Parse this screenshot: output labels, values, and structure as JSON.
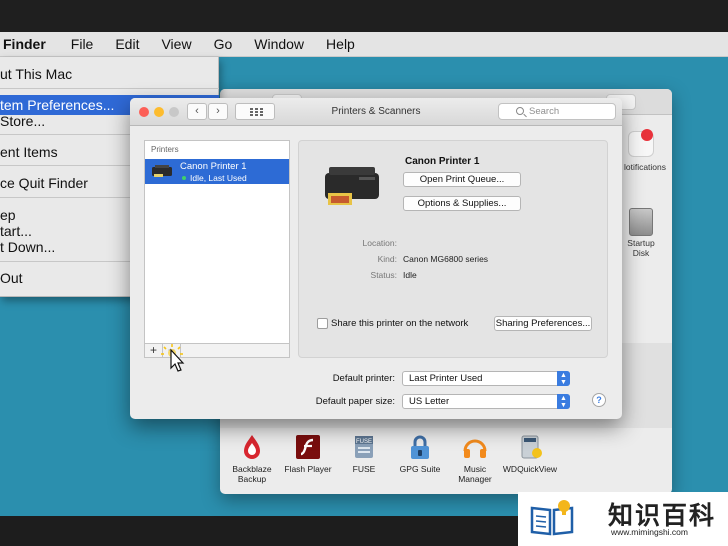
{
  "menubar": {
    "app_name": "Finder",
    "items": [
      "File",
      "Edit",
      "View",
      "Go",
      "Window",
      "Help"
    ]
  },
  "apple_menu": {
    "items": [
      {
        "label": "ut This Mac"
      },
      {
        "label": "tem Preferences...",
        "highlighted": true
      },
      {
        "label": "Store..."
      },
      {
        "label": "ent Items"
      },
      {
        "label": "ce Quit Finder"
      },
      {
        "label": "ep"
      },
      {
        "label": "tart..."
      },
      {
        "label": "t Down..."
      },
      {
        "label": "Out"
      }
    ]
  },
  "sysprefs": {
    "notifications_label": "lotifications",
    "startup_disk_label": [
      "Startup",
      "Disk"
    ],
    "apps": [
      {
        "label": [
          "Backblaze",
          "Backup"
        ],
        "icon": "backblaze-icon"
      },
      {
        "label": [
          "Flash Player"
        ],
        "icon": "flash-player-icon"
      },
      {
        "label": [
          "FUSE"
        ],
        "icon": "fuse-icon"
      },
      {
        "label": [
          "GPG Suite"
        ],
        "icon": "gpg-suite-icon"
      },
      {
        "label": [
          "Music",
          "Manager"
        ],
        "icon": "music-manager-icon"
      },
      {
        "label": [
          "WDQuickView"
        ],
        "icon": "wdquickview-icon"
      }
    ]
  },
  "printers_window": {
    "title": "Printers & Scanners",
    "search_placeholder": "Search",
    "list_header": "Printers",
    "printer": {
      "name": "Canon Printer 1",
      "status": "Idle, Last Used"
    },
    "detail": {
      "name": "Canon Printer 1",
      "open_queue_label": "Open Print Queue...",
      "options_label": "Options & Supplies...",
      "location_key": "Location:",
      "location_value": "",
      "kind_key": "Kind:",
      "kind_value": "Canon MG6800 series",
      "status_key": "Status:",
      "status_value": "Idle",
      "share_label": "Share this printer on the network",
      "share_checked": false,
      "sharing_prefs_label": "Sharing Preferences..."
    },
    "default_printer_label": "Default printer:",
    "default_printer_value": "Last Printer Used",
    "default_paper_label": "Default paper size:",
    "default_paper_value": "US Letter",
    "add_label": "+",
    "remove_label": "−",
    "help_label": "?"
  },
  "watermark": {
    "chinese": "知识百科",
    "url": "www.mimingshi.com"
  },
  "colors": {
    "desktop": "#2b8fae",
    "selection": "#2d6bd5",
    "menu_highlight": "#2f69d6",
    "close": "#fc5f57",
    "minimize": "#fdbc2e",
    "zoom": "#c8c8c8"
  }
}
